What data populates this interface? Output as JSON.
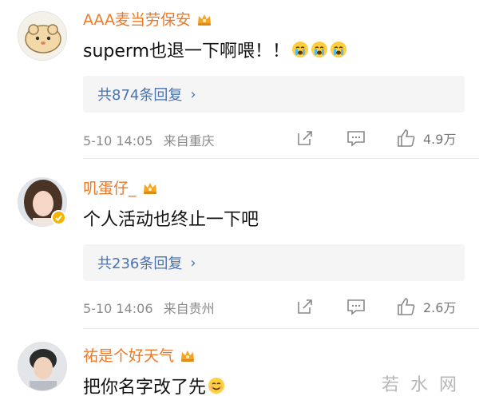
{
  "comments": [
    {
      "username": "AAA麦当劳保安",
      "text": "superm也退一下啊喂！！",
      "emoji_icons": [
        "crying-face-icon",
        "crying-face-icon",
        "crying-face-icon"
      ],
      "replies_label": "共874条回复",
      "timestamp": "5-10 14:05",
      "location": "来自重庆",
      "likes": "4.9万"
    },
    {
      "username": "叽蛋仔_",
      "text": "个人活动也终止一下吧",
      "replies_label": "共236条回复",
      "timestamp": "5-10 14:06",
      "location": "来自贵州",
      "likes": "2.6万"
    },
    {
      "username": "祐是个好天气",
      "text": "把你名字改了先",
      "emoji_icons": [
        "smiling-face-icon"
      ]
    }
  ],
  "watermark": "若水网",
  "colors": {
    "username": "#ea7a2a",
    "reply_link": "#4a72b0",
    "meta": "#8a8a8a",
    "badge": "#f7b500"
  }
}
